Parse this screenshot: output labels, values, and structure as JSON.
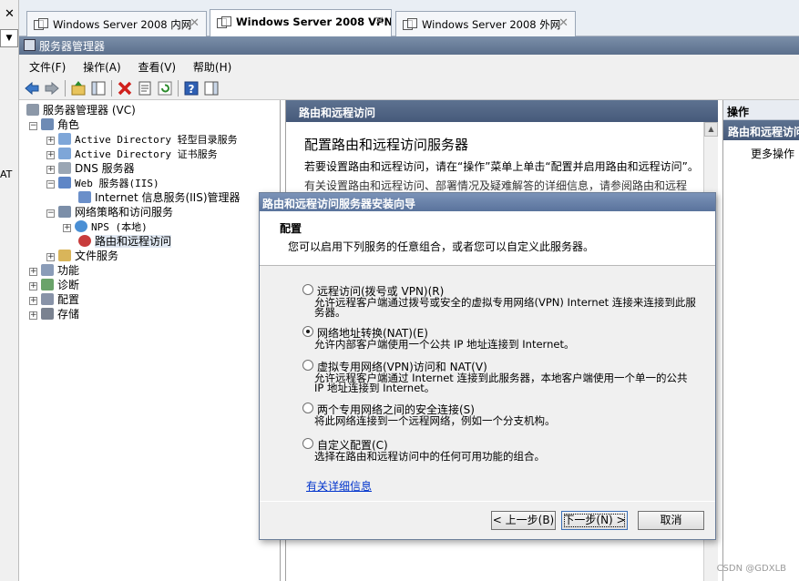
{
  "left_strip": {
    "close_glyph": "✕",
    "dropdown_glyph": "▼",
    "label": "AT"
  },
  "tabs": [
    {
      "label": "Windows Server 2008 内网",
      "active": false,
      "icon": "vm-icon"
    },
    {
      "label": "Windows Server 2008 VPN...",
      "active": true,
      "icon": "vm-icon"
    },
    {
      "label": "Windows Server 2008 外网",
      "active": false,
      "icon": "vm-icon"
    }
  ],
  "window": {
    "title": "服务器管理器"
  },
  "menu": [
    "文件(F)",
    "操作(A)",
    "查看(V)",
    "帮助(H)"
  ],
  "toolbar": [
    "back-icon",
    "forward-icon",
    "up-folder-icon",
    "show-tree-icon",
    "delete-icon",
    "properties-icon",
    "refresh-icon",
    "help-icon",
    "show-action-pane-icon"
  ],
  "tree": {
    "root": "服务器管理器 (VC)",
    "roles": "角色",
    "ad_lds": "Active Directory 轻型目录服务",
    "ad_cs": "Active Directory 证书服务",
    "dns": "DNS 服务器",
    "web": "Web 服务器(IIS)",
    "iis_manager": "Internet 信息服务(IIS)管理器",
    "npas": "网络策略和访问服务",
    "nps": "NPS (本地)",
    "rras": "路由和远程访问",
    "file": "文件服务",
    "features": "功能",
    "diagnostics": "诊断",
    "configuration": "配置",
    "storage": "存储"
  },
  "middle": {
    "header": "路由和远程访问",
    "heading": "配置路由和远程访问服务器",
    "para1": "若要设置路由和远程访问，请在“操作”菜单上单击“配置并启用路由和远程访问”。",
    "para2": "有关设置路由和远程访问、部署情况及疑难解答的详细信息，请参阅路由和远程"
  },
  "actions": {
    "title": "操作",
    "selected": "路由和远程访问",
    "more": "更多操作"
  },
  "wizard": {
    "title": "路由和远程访问服务器安装向导",
    "heading": "配置",
    "subtitle": "您可以启用下列服务的任意组合，或者您可以自定义此服务器。",
    "options": [
      {
        "label": "远程访问(拨号或 VPN)(R)",
        "desc": "允许远程客户端通过拨号或安全的虚拟专用网络(VPN) Internet 连接来连接到此服务器。",
        "checked": false
      },
      {
        "label": "网络地址转换(NAT)(E)",
        "desc": "允许内部客户端使用一个公共 IP 地址连接到 Internet。",
        "checked": true
      },
      {
        "label": "虚拟专用网络(VPN)访问和 NAT(V)",
        "desc": "允许远程客户端通过 Internet 连接到此服务器，本地客户端使用一个单一的公共 IP 地址连接到 Internet。",
        "checked": false
      },
      {
        "label": "两个专用网络之间的安全连接(S)",
        "desc": "将此网络连接到一个远程网络，例如一个分支机构。",
        "checked": false
      },
      {
        "label": "自定义配置(C)",
        "desc": "选择在路由和远程访问中的任何可用功能的组合。",
        "checked": false
      }
    ],
    "link": "有关详细信息",
    "back": "< 上一步(B)",
    "next": "下一步(N) >",
    "cancel": "取消"
  },
  "watermark": "CSDN @GDXLB"
}
